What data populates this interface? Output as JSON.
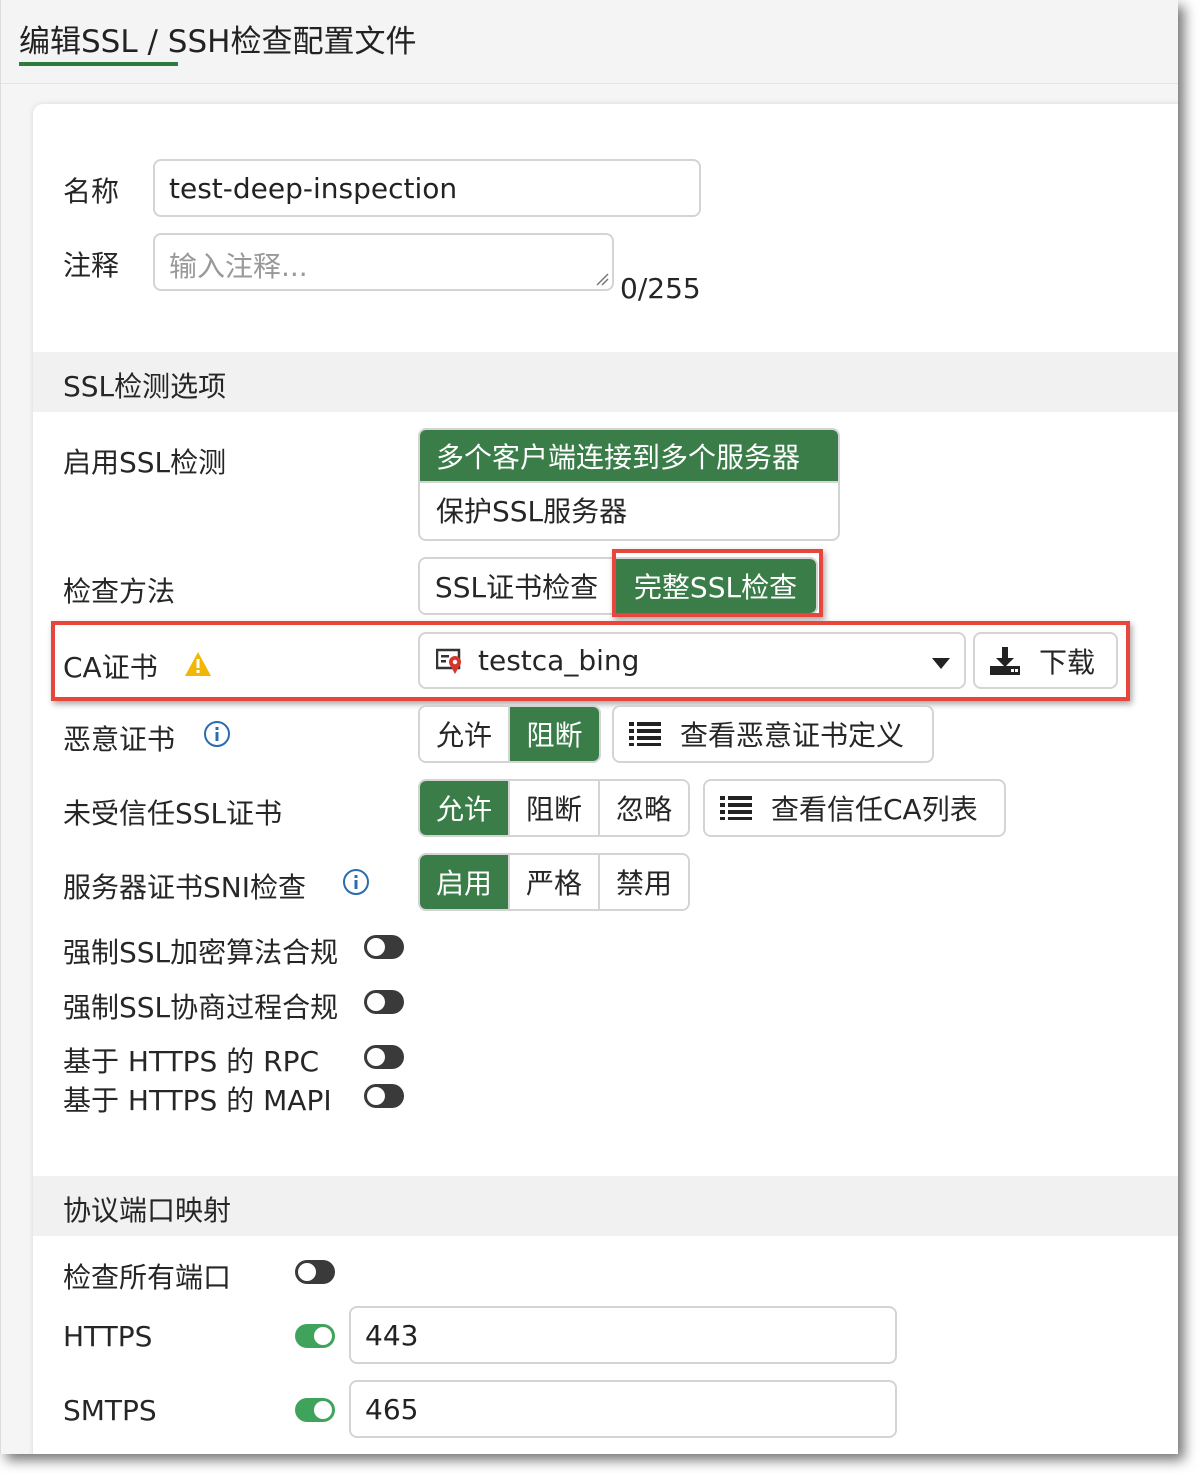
{
  "header": {
    "title": "编辑SSL / SSH检查配置文件"
  },
  "form": {
    "name_label": "名称",
    "name_value": "test-deep-inspection",
    "comment_label": "注释",
    "comment_placeholder": "输入注释...",
    "comment_counter": "0/255"
  },
  "ssl_section": {
    "title": "SSL检测选项",
    "enable_label": "启用SSL检测",
    "enable_options": [
      "多个客户端连接到多个服务器",
      "保护SSL服务器"
    ],
    "method_label": "检查方法",
    "method_options": [
      "SSL证书检查",
      "完整SSL检查"
    ],
    "ca_label": "CA证书",
    "ca_value": "testca_bing",
    "download_label": "下载",
    "malicious_label": "恶意证书",
    "malicious_options": [
      "允许",
      "阻断"
    ],
    "malicious_view": "查看恶意证书定义",
    "untrusted_label": "未受信任SSL证书",
    "untrusted_options": [
      "允许",
      "阻断",
      "忽略"
    ],
    "untrusted_view": "查看信任CA列表",
    "sni_label": "服务器证书SNI检查",
    "sni_options": [
      "启用",
      "严格",
      "禁用"
    ],
    "cipher_label": "强制SSL加密算法合规",
    "negotiation_label": "强制SSL协商过程合规",
    "rpc_label": "基于 HTTPS 的 RPC",
    "mapi_label": "基于 HTTPS 的 MAPI"
  },
  "port_section": {
    "title": "协议端口映射",
    "all_ports_label": "检查所有端口",
    "https_label": "HTTPS",
    "https_value": "443",
    "smtps_label": "SMTPS",
    "smtps_value": "465"
  },
  "colors": {
    "accent": "#3a7d49",
    "toggle_on": "#3fa35c",
    "highlight": "#e8453c",
    "warning": "#f2b705",
    "info": "#2b6cb0"
  },
  "icons": [
    "resize-grip-icon",
    "warning-icon",
    "certificate-icon",
    "caret-down-icon",
    "download-icon",
    "info-icon",
    "list-icon"
  ]
}
